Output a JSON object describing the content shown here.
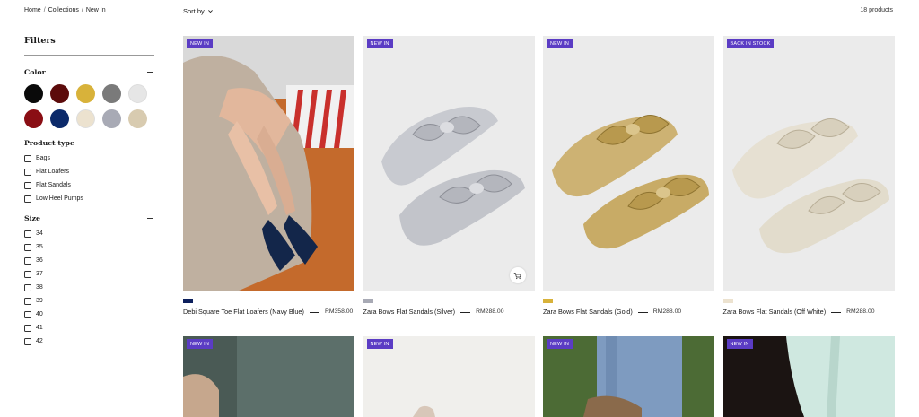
{
  "breadcrumb": [
    "Home",
    "Collections",
    "New In"
  ],
  "breadcrumb_sep": "/",
  "sort_label": "Sort by",
  "product_count": "18 products",
  "filters": {
    "title": "Filters",
    "color": {
      "label": "Color",
      "swatches": [
        "#0a0a0a",
        "#5c0b0b",
        "#d8b23a",
        "#7a7a7a",
        "#e6e6e6",
        "#8a0e14",
        "#0c2a6a",
        "#ece2cf",
        "#a8aab5",
        "#d8cbb0"
      ]
    },
    "product_type": {
      "label": "Product type",
      "options": [
        "Bags",
        "Flat Loafers",
        "Flat Sandals",
        "Low Heel Pumps"
      ]
    },
    "size": {
      "label": "Size",
      "options": [
        "34",
        "35",
        "36",
        "37",
        "38",
        "39",
        "40",
        "41",
        "42"
      ]
    }
  },
  "products": [
    {
      "badge": "NEW IN",
      "name": "Debi Square Toe Flat Loafers (Navy Blue)",
      "price": "RM358.00",
      "color": "#0c1f5c",
      "image": "loafers-on-model"
    },
    {
      "badge": "NEW IN",
      "name": "Zara Bows Flat Sandals (Silver)",
      "price": "RM288.00",
      "color": "#a8aab5",
      "image": "silver-bow-sandals",
      "quick_add": true
    },
    {
      "badge": "NEW IN",
      "name": "Zara Bows Flat Sandals (Gold)",
      "price": "RM288.00",
      "color": "#d8b23a",
      "image": "gold-bow-sandals"
    },
    {
      "badge": "BACK IN STOCK",
      "name": "Zara Bows Flat Sandals (Off White)",
      "price": "RM288.00",
      "color": "#ece2cf",
      "image": "offwhite-bow-sandals"
    }
  ],
  "products_row2": [
    {
      "badge": "NEW IN",
      "image": "teal-lifestyle"
    },
    {
      "badge": "NEW IN",
      "image": "white-studio"
    },
    {
      "badge": "NEW IN",
      "image": "denim-grass"
    },
    {
      "badge": "NEW IN",
      "image": "mint-dress-dark"
    }
  ],
  "icons": {
    "sort": "chevron-down-icon",
    "cart": "cart-icon",
    "collapse": "minus-icon"
  }
}
